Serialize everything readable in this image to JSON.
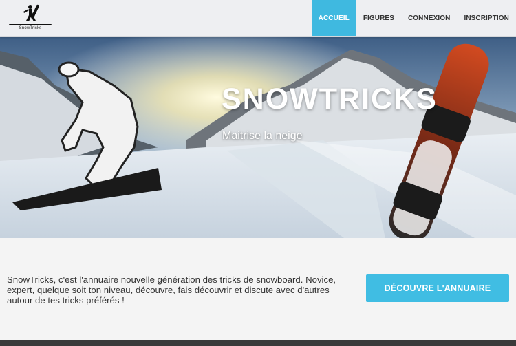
{
  "brand": {
    "logo_text": "SnowTricks"
  },
  "nav": {
    "items": [
      {
        "label": "ACCUEIL",
        "active": true
      },
      {
        "label": "FIGURES",
        "active": false
      },
      {
        "label": "CONNEXION",
        "active": false
      },
      {
        "label": "INSCRIPTION",
        "active": false
      }
    ]
  },
  "hero": {
    "title": "SNOWTRICKS",
    "subtitle": "Maitrise la neige"
  },
  "intro": {
    "text": "SnowTricks, c'est l'annuaire nouvelle génération des tricks de snowboard. Novice, expert, quelque soit ton niveau, découvre, fais découvrir et discute avec d'autres autour de tes tricks préférés !",
    "cta_label": "DÉCOUVRE L'ANNUAIRE"
  },
  "colors": {
    "accent": "#3fb9e0",
    "navbar_bg": "#eeeff2",
    "page_bg": "#f4f4f4",
    "footer": "#3a3a3a"
  },
  "icons": [
    "snowboarder-logo-icon"
  ]
}
